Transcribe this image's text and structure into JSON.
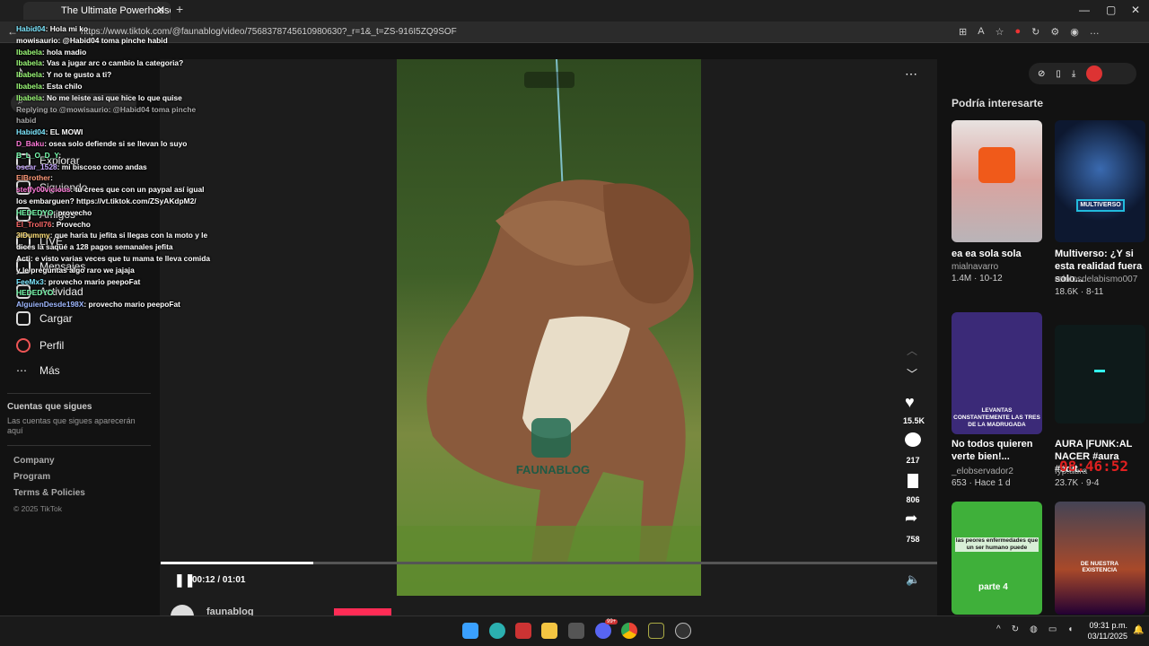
{
  "browser": {
    "tab_title": "The Ultimate Powerhouse -",
    "url": "https://www.tiktok.com/@faunablog/video/7568378745610980630?_r=1&_t=ZS-916I5ZQ9SOF"
  },
  "sidebar": {
    "items": [
      {
        "label": "Explorar"
      },
      {
        "label": "Siguiendo"
      },
      {
        "label": "Amigos"
      },
      {
        "label": "LIVE"
      },
      {
        "label": "Mensajes"
      },
      {
        "label": "Actividad"
      },
      {
        "label": "Cargar"
      },
      {
        "label": "Perfil"
      },
      {
        "label": "Más"
      }
    ],
    "following_title": "Cuentas que sigues",
    "following_desc": "Las cuentas que sigues aparecerán aquí",
    "footer": [
      "Company",
      "Program",
      "Terms & Policies",
      "© 2025 TikTok"
    ]
  },
  "video": {
    "watermark": "FAUNABLOG",
    "time": "00:12 / 01:01",
    "progress_fraction": 0.197,
    "author": "faunablog",
    "likes": "15.5K",
    "comments": "217",
    "saves": "806",
    "shares": "758"
  },
  "recommendations": {
    "title": "Podría interesarte",
    "cards": [
      {
        "title": "ea ea sola sola",
        "author": "mialnavarro",
        "stats": "1.4M · 10-12"
      },
      {
        "title": "Multiverso: ¿Y si esta realidad fuera solo...",
        "author": "relatosdelabismo007",
        "stats": "18.6K · 8-11",
        "badge": "MULTIVERSO"
      },
      {
        "title": "No todos quieren verte bien!...",
        "author": "_elobservador2",
        "stats": "653 · Hace 1 d",
        "overlay": "LEVANTAS CONSTANTEMENTE LAS TRES DE LA MADRUGADA"
      },
      {
        "title": "AURA |FUNK:AL NACER #aura #edit...",
        "author": "fyp.aura",
        "stats": "23.7K · 9-4"
      },
      {
        "overlay": "las peores enfermedades que un ser humano puede",
        "overlay2": "parte 4"
      },
      {
        "overlay": "DE NUESTRA EXISTENCIA"
      }
    ]
  },
  "timer": "08:46:52",
  "chat": [
    {
      "user": "Habid04",
      "text": "Hola mi ko",
      "color": "#7ee8ff"
    },
    {
      "user": "mowisaurio",
      "text": "@Habid04 toma pinche habid",
      "color": "#ffffff"
    },
    {
      "user": "Ibabela",
      "text": "hola madio",
      "color": "#9fff7a"
    },
    {
      "user": "Ibabela",
      "text": "Vas a jugar arc o cambio la categoria?",
      "color": "#9fff7a"
    },
    {
      "user": "Ibabela",
      "text": "Y no te gusto a ti?",
      "color": "#9fff7a"
    },
    {
      "user": "Ibabela",
      "text": "Esta chilo",
      "color": "#9fff7a"
    },
    {
      "user": "Ibabela",
      "text": "No me leiste asi que hice lo que quise",
      "color": "#9fff7a"
    },
    {
      "user": "",
      "text": "Replying to @mowisaurio: @Habid04 toma pinche habid",
      "color": "#aaaaaa"
    },
    {
      "user": "Habid04",
      "text": "EL MOWI",
      "color": "#7ee8ff"
    },
    {
      "user": "D_Baku",
      "text": "osea solo defiende si se llevan lo suyo",
      "color": "#ff7ad9"
    },
    {
      "user": "B_L_O_D_Y",
      "text": "",
      "color": "#7affb0"
    },
    {
      "user": "oscar_1528",
      "text": "mi biscoso como andas",
      "color": "#c8a8ff"
    },
    {
      "user": "ElBrother",
      "text": "",
      "color": "#ff9a7a"
    },
    {
      "user": "steffy00vicious",
      "text": "tú crees que con un paypal así igual los embarguen? https://vt.tiktok.com/ZSyAKdpM2/",
      "color": "#ff7ad9"
    },
    {
      "user": "HEDEDYO",
      "text": "provecho",
      "color": "#7affb0"
    },
    {
      "user": "El_Troll76",
      "text": "Provecho",
      "color": "#ff6a6a"
    },
    {
      "user": "3IDummy",
      "text": "que haria tu jefita si llegas con la moto y le dices la saqué a 128 pagos semanales jefita",
      "color": "#ffe07a"
    },
    {
      "user": "Acti",
      "text": "e visto varias veces que tu mama te lleva comida y le preguntas algo raro we jajaja",
      "color": "#ffffff"
    },
    {
      "user": "FeeMx3",
      "text": "provecho mario peepoFat",
      "color": "#7ee8ff"
    },
    {
      "user": "HEDEDYO",
      "text": "",
      "color": "#7affb0"
    },
    {
      "user": "AlguienDesde198X",
      "text": "provecho mario peepoFat",
      "color": "#9fb8ff"
    }
  ],
  "taskbar": {
    "time": "09:31 p.m.",
    "date": "03/11/2025",
    "badge": "99+"
  }
}
